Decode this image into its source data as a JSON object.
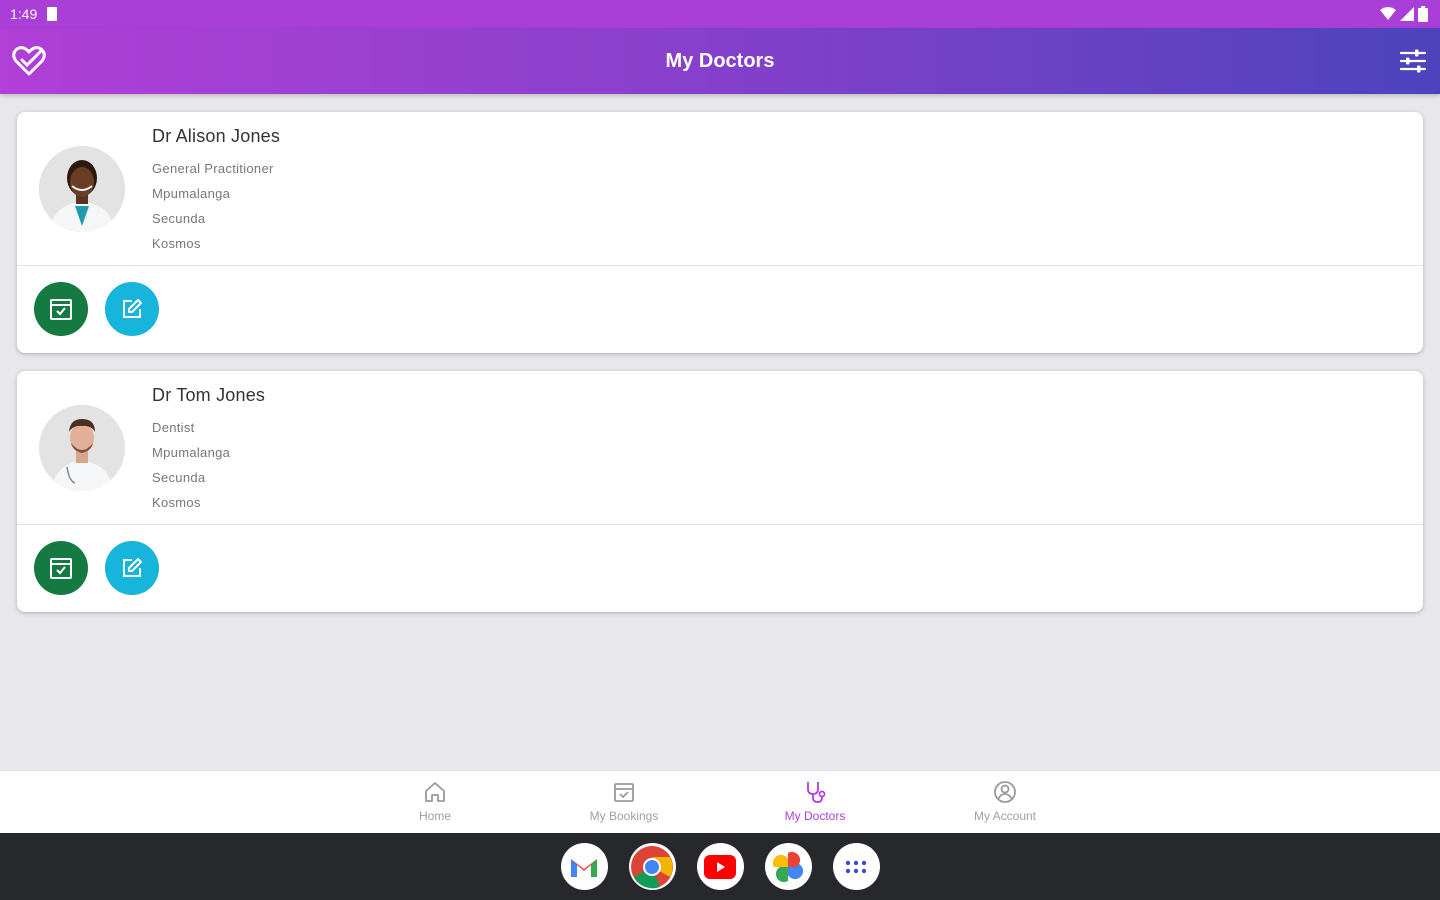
{
  "status_bar": {
    "time": "1:49"
  },
  "app_bar": {
    "title": "My Doctors",
    "logo_icon": "heart-check-icon",
    "filter_icon": "sliders-icon",
    "gradient_start": "#b13fd8",
    "gradient_end": "#4d43bd"
  },
  "doctors": [
    {
      "name": "Dr Alison Jones",
      "specialty": "General Practitioner",
      "province": "Mpumalanga",
      "city": "Secunda",
      "suburb": "Kosmos",
      "avatar_icon": "doctor-female-avatar"
    },
    {
      "name": "Dr Tom Jones",
      "specialty": "Dentist",
      "province": "Mpumalanga",
      "city": "Secunda",
      "suburb": "Kosmos",
      "avatar_icon": "doctor-male-avatar"
    }
  ],
  "action_colors": {
    "book": "#147a42",
    "edit": "#17b4dc"
  },
  "bottom_nav": {
    "items": [
      {
        "label": "Home",
        "icon": "home-icon",
        "active": false
      },
      {
        "label": "My Bookings",
        "icon": "calendar-icon",
        "active": false
      },
      {
        "label": "My Doctors",
        "icon": "stethoscope-icon",
        "active": true
      },
      {
        "label": "My Account",
        "icon": "account-icon",
        "active": false
      }
    ],
    "active_color": "#b13fd8"
  },
  "dock": {
    "apps": [
      "gmail-icon",
      "chrome-icon",
      "youtube-icon",
      "photos-icon",
      "app-drawer-icon"
    ]
  }
}
